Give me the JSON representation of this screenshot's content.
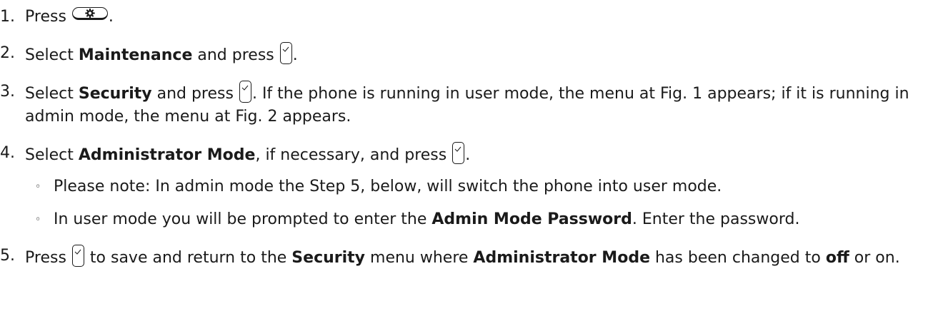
{
  "steps": [
    {
      "num": "1.",
      "text_a": "Press ",
      "text_b": "."
    },
    {
      "num": "2.",
      "text_a": "Select ",
      "bold_a": "Maintenance",
      "text_b": " and press ",
      "text_c": "."
    },
    {
      "num": "3.",
      "text_a": "Select ",
      "bold_a": "Security",
      "text_b": " and press ",
      "text_c": ".  If the phone is running in user mode, the menu at Fig. 1 appears; if it is running in admin mode, the menu at Fig. 2 appears."
    },
    {
      "num": "4.",
      "text_a": "Select ",
      "bold_a": "Administrator Mode",
      "text_b": ", if necessary, and press ",
      "text_c": ".",
      "substeps": [
        {
          "bullet": "◦",
          "text_a": "Please note: In admin mode the Step 5, below, will switch the phone into user mode."
        },
        {
          "bullet": "◦",
          "text_a": "In user mode you will be prompted to enter the ",
          "bold_a": "Admin Mode Password",
          "text_b": ".  Enter the password."
        }
      ]
    },
    {
      "num": "5.",
      "text_a": "Press ",
      "text_b": " to save and return to the ",
      "bold_a": "Security",
      "text_c": " menu where ",
      "bold_b": "Administrator Mode",
      "text_d": " has been changed to ",
      "bold_c": "off",
      "text_e": " or on."
    }
  ],
  "icons": {
    "settings_key": "settings-key-icon",
    "ok_key": "ok-checkmark-key-icon"
  }
}
